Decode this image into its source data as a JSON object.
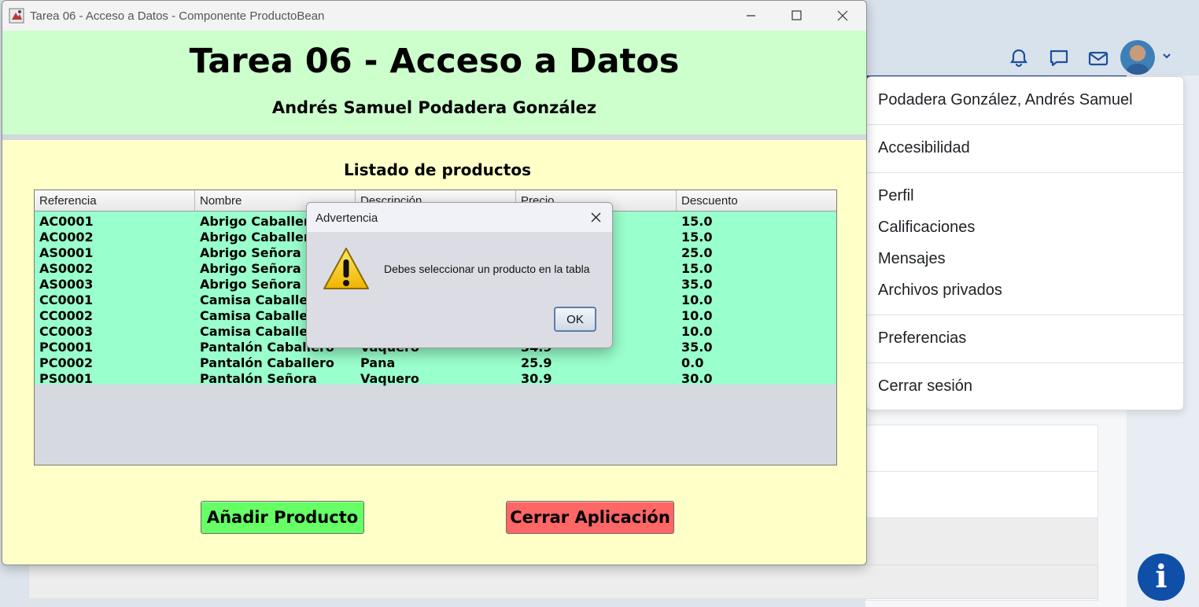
{
  "window": {
    "title": "Tarea 06 - Acceso a Datos - Componente ProductoBean",
    "heading": "Tarea 06 - Acceso a Datos",
    "author": "Andrés Samuel Podadera González",
    "list_title": "Listado de productos"
  },
  "table": {
    "columns": [
      "Referencia",
      "Nombre",
      "Descripción",
      "Precio",
      "Descuento"
    ],
    "rows": [
      [
        "AC0001",
        "Abrigo Caballero",
        "",
        "",
        "15.0"
      ],
      [
        "AC0002",
        "Abrigo Caballero",
        "",
        "",
        "15.0"
      ],
      [
        "AS0001",
        "Abrigo Señora",
        "",
        "",
        "25.0"
      ],
      [
        "AS0002",
        "Abrigo Señora",
        "",
        "",
        "15.0"
      ],
      [
        "AS0003",
        "Abrigo Señora",
        "",
        "",
        "35.0"
      ],
      [
        "CC0001",
        "Camisa Caballero",
        "",
        "",
        "10.0"
      ],
      [
        "CC0002",
        "Camisa Caballero",
        "",
        "",
        "10.0"
      ],
      [
        "CC0003",
        "Camisa Caballero",
        "",
        "",
        "10.0"
      ],
      [
        "PC0001",
        "Pantalón Caballero",
        "Vaquero",
        "34.9",
        "35.0"
      ],
      [
        "PC0002",
        "Pantalón Caballero",
        "Pana",
        "25.9",
        "0.0"
      ],
      [
        "PS0001",
        "Pantalón Señora",
        "Vaquero",
        "30.9",
        "30.0"
      ]
    ]
  },
  "buttons": {
    "add": "Añadir Producto",
    "close": "Cerrar Aplicación"
  },
  "dialog": {
    "title": "Advertencia",
    "message": "Debes seleccionar un producto en la tabla",
    "ok": "OK"
  },
  "user_menu": {
    "name": "Podadera González, Andrés Samuel",
    "items": [
      "Accesibilidad",
      "Perfil",
      "Calificaciones",
      "Mensajes",
      "Archivos privados",
      "Preferencias",
      "Cerrar sesión"
    ]
  },
  "info_button": "i",
  "colors": {
    "header_bg": "#ccffcc",
    "window_bg": "#ffffc8",
    "table_rows": "#99ffcc",
    "add_button": "#66ff66",
    "close_button": "#ff6666",
    "nav_blue": "#1e3f7c"
  }
}
